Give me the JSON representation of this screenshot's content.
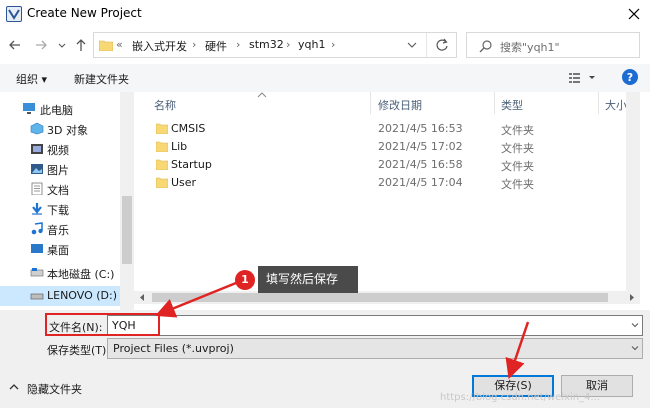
{
  "window": {
    "title": "Create New Project"
  },
  "nav": {
    "breadcrumbs": [
      {
        "sep": "«"
      },
      {
        "label": "嵌入式开发"
      },
      {
        "sep": "›"
      },
      {
        "label": "硬件"
      },
      {
        "sep": "›"
      },
      {
        "label": "stm32"
      },
      {
        "sep": "›"
      },
      {
        "label": "yqh1"
      },
      {
        "sep": "›"
      }
    ],
    "search_placeholder": "搜索\"yqh1\""
  },
  "toolbar": {
    "organize_label": "组织 ▾",
    "new_folder_label": "新建文件夹"
  },
  "sidebar": {
    "items": [
      {
        "label": "此电脑",
        "icon": "computer-icon"
      },
      {
        "label": "3D 对象",
        "icon": "cube-icon"
      },
      {
        "label": "视频",
        "icon": "video-icon"
      },
      {
        "label": "图片",
        "icon": "picture-icon"
      },
      {
        "label": "文档",
        "icon": "document-icon"
      },
      {
        "label": "下载",
        "icon": "download-icon"
      },
      {
        "label": "音乐",
        "icon": "music-icon"
      },
      {
        "label": "桌面",
        "icon": "desktop-icon"
      },
      {
        "label": "本地磁盘 (C:)",
        "icon": "drive-icon"
      },
      {
        "label": "LENOVO (D:)",
        "icon": "drive-icon",
        "selected": true
      }
    ]
  },
  "files": {
    "columns": {
      "name": "名称",
      "modified": "修改日期",
      "type": "类型",
      "size": "大小"
    },
    "rows": [
      {
        "name": "CMSIS",
        "modified": "2021/4/5 16:53",
        "type": "文件夹"
      },
      {
        "name": "Lib",
        "modified": "2021/4/5 17:02",
        "type": "文件夹"
      },
      {
        "name": "Startup",
        "modified": "2021/4/5 16:58",
        "type": "文件夹"
      },
      {
        "name": "User",
        "modified": "2021/4/5 17:04",
        "type": "文件夹"
      }
    ]
  },
  "annotation": {
    "step": "1",
    "text": "填写然后保存"
  },
  "form": {
    "filename_label": "文件名(N):",
    "filename_value": "YQH",
    "filetype_label": "保存类型(T):",
    "filetype_value": "Project Files (*.uvproj)"
  },
  "footer": {
    "hide_folders_label": "隐藏文件夹",
    "save_label": "保存(S)",
    "cancel_label": "取消",
    "watermark": "https://blog.csdn.net/weixin_4..."
  },
  "colors": {
    "accent": "#0078d7",
    "annotation_red": "#e02424",
    "folder": "#f8d775"
  }
}
